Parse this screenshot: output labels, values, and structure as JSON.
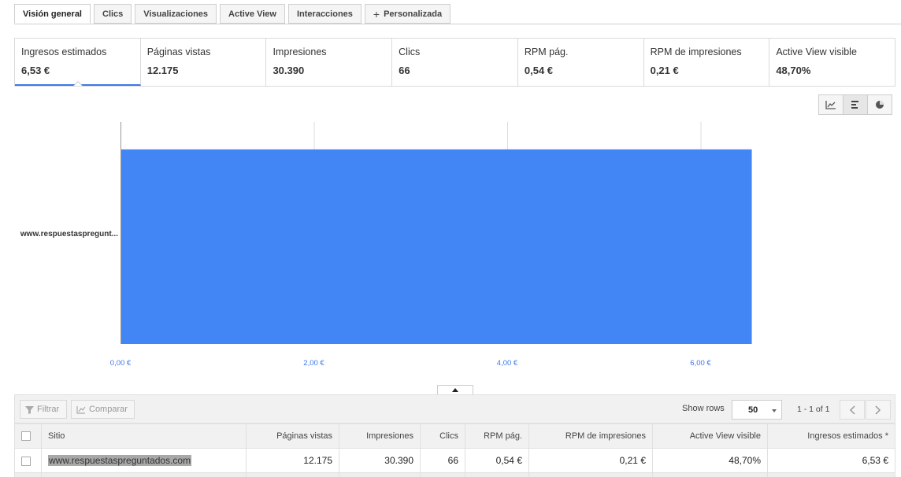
{
  "tabs": [
    {
      "label": "Visión general",
      "active": true
    },
    {
      "label": "Clics"
    },
    {
      "label": "Visualizaciones"
    },
    {
      "label": "Active View"
    },
    {
      "label": "Interacciones"
    },
    {
      "label": "Personalizada",
      "icon": "plus-icon"
    }
  ],
  "metrics": [
    {
      "label": "Ingresos estimados",
      "value": "6,53 €",
      "active": true
    },
    {
      "label": "Páginas vistas",
      "value": "12.175"
    },
    {
      "label": "Impresiones",
      "value": "30.390"
    },
    {
      "label": "Clics",
      "value": "66"
    },
    {
      "label": "RPM pág.",
      "value": "0,54 €"
    },
    {
      "label": "RPM de impresiones",
      "value": "0,21 €"
    },
    {
      "label": "Active View visible",
      "value": "48,70%"
    }
  ],
  "chart_types": [
    {
      "icon": "line-chart-icon"
    },
    {
      "icon": "bar-chart-icon",
      "active": true
    },
    {
      "icon": "pie-chart-icon"
    }
  ],
  "chart_data": {
    "type": "bar",
    "orientation": "horizontal",
    "categories": [
      "www.respuestaspregunt..."
    ],
    "values": [
      6.53
    ],
    "xlim": [
      0,
      8
    ],
    "x_ticks": [
      0,
      2,
      4,
      6
    ],
    "x_tick_labels": [
      "0,00 €",
      "2,00 €",
      "4,00 €",
      "6,00 €"
    ],
    "grid": true,
    "color": "#4285f4"
  },
  "toolbar": {
    "filter_label": "Filtrar",
    "compare_label": "Comparar",
    "show_rows_label": "Show rows",
    "rows_value": "50",
    "page_info": "1 - 1 of 1"
  },
  "table": {
    "columns": [
      "Sitio",
      "Páginas vistas",
      "Impresiones",
      "Clics",
      "RPM pág.",
      "RPM de impresiones",
      "Active View visible",
      "Ingresos estimados *"
    ],
    "rows": [
      [
        "www.respuestaspreguntados.com",
        "12.175",
        "30.390",
        "66",
        "0,54 €",
        "0,21 €",
        "48,70%",
        "6,53 €"
      ]
    ]
  }
}
